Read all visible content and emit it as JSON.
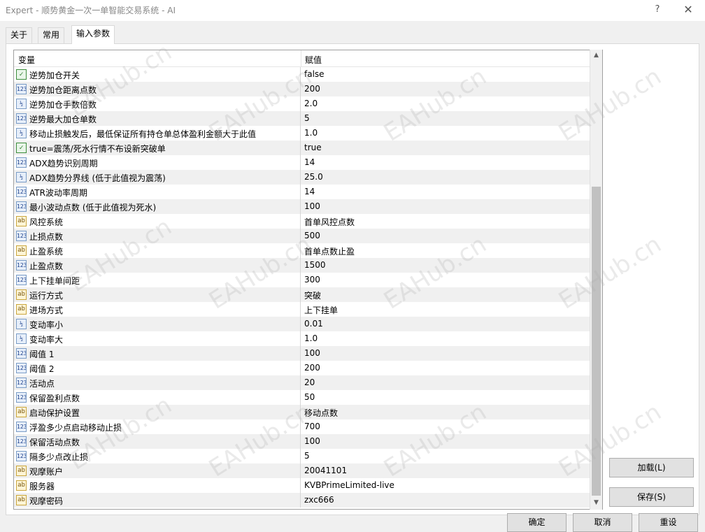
{
  "window": {
    "title": "Expert - 顺势黄金一次一单智能交易系统 - AI",
    "help_label": "?",
    "close_label": "✕"
  },
  "tabs": [
    {
      "label": "关于"
    },
    {
      "label": "常用"
    },
    {
      "label": "输入参数"
    }
  ],
  "grid": {
    "col_variable": "变量",
    "col_value": "赋值",
    "rows": [
      {
        "icon": "boolean-icon",
        "icon_text": "✓",
        "name": "逆势加仓开关",
        "value": "false"
      },
      {
        "icon": "integer-icon",
        "icon_text": "123",
        "name": "逆势加仓距离点数",
        "value": "200"
      },
      {
        "icon": "double-icon",
        "icon_text": "½",
        "name": "逆势加仓手数倍数",
        "value": "2.0"
      },
      {
        "icon": "integer-icon",
        "icon_text": "123",
        "name": "逆势最大加仓单数",
        "value": "5"
      },
      {
        "icon": "double-icon",
        "icon_text": "½",
        "name": "移动止损触发后，最低保证所有持仓单总体盈利金额大于此值",
        "value": "1.0"
      },
      {
        "icon": "boolean-icon",
        "icon_text": "✓",
        "name": "true=震荡/死水行情不布设新突破单",
        "value": "true"
      },
      {
        "icon": "integer-icon",
        "icon_text": "123",
        "name": "ADX趋势识别周期",
        "value": "14"
      },
      {
        "icon": "double-icon",
        "icon_text": "½",
        "name": "ADX趋势分界线 (低于此值视为震荡)",
        "value": "25.0"
      },
      {
        "icon": "integer-icon",
        "icon_text": "123",
        "name": "ATR波动率周期",
        "value": "14"
      },
      {
        "icon": "integer-icon",
        "icon_text": "123",
        "name": "最小波动点数 (低于此值视为死水)",
        "value": "100"
      },
      {
        "icon": "string-icon",
        "icon_text": "ab",
        "name": "风控系统",
        "value": " 首单风控点数"
      },
      {
        "icon": "integer-icon",
        "icon_text": "123",
        "name": "止损点数",
        "value": "500"
      },
      {
        "icon": "string-icon",
        "icon_text": "ab",
        "name": "止盈系统",
        "value": " 首单点数止盈"
      },
      {
        "icon": "integer-icon",
        "icon_text": "123",
        "name": "止盈点数",
        "value": "1500"
      },
      {
        "icon": "integer-icon",
        "icon_text": "123",
        "name": "上下挂单间距",
        "value": "300"
      },
      {
        "icon": "string-icon",
        "icon_text": "ab",
        "name": "运行方式",
        "value": "突破"
      },
      {
        "icon": "string-icon",
        "icon_text": "ab",
        "name": "进场方式",
        "value": "上下挂单"
      },
      {
        "icon": "double-icon",
        "icon_text": "½",
        "name": "变动率小",
        "value": "0.01"
      },
      {
        "icon": "double-icon",
        "icon_text": "½",
        "name": "变动率大",
        "value": "1.0"
      },
      {
        "icon": "integer-icon",
        "icon_text": "123",
        "name": "阈值 1",
        "value": "100"
      },
      {
        "icon": "integer-icon",
        "icon_text": "123",
        "name": "阈值 2",
        "value": "200"
      },
      {
        "icon": "integer-icon",
        "icon_text": "123",
        "name": "活动点",
        "value": "20"
      },
      {
        "icon": "integer-icon",
        "icon_text": "123",
        "name": "保留盈利点数",
        "value": "50"
      },
      {
        "icon": "string-icon",
        "icon_text": "ab",
        "name": "启动保护设置",
        "value": "移动点数"
      },
      {
        "icon": "integer-icon",
        "icon_text": "123",
        "name": "浮盈多少点启动移动止损",
        "value": "700"
      },
      {
        "icon": "integer-icon",
        "icon_text": "123",
        "name": "保留活动点数",
        "value": "100"
      },
      {
        "icon": "integer-icon",
        "icon_text": "123",
        "name": "隔多少点改止损",
        "value": "5"
      },
      {
        "icon": "string-icon",
        "icon_text": "ab",
        "name": "观摩账户",
        "value": "20041101"
      },
      {
        "icon": "string-icon",
        "icon_text": "ab",
        "name": "服务器",
        "value": "KVBPrimeLimited-live"
      },
      {
        "icon": "string-icon",
        "icon_text": "ab",
        "name": "观摩密码",
        "value": "zxc666"
      }
    ]
  },
  "buttons": {
    "load": "加载(L)",
    "save": "保存(S)",
    "ok": "确定",
    "cancel": "取消",
    "reset": "重设"
  },
  "scrollbar": {
    "up": "▲",
    "down": "▼"
  },
  "watermark": "EAHub.cn"
}
